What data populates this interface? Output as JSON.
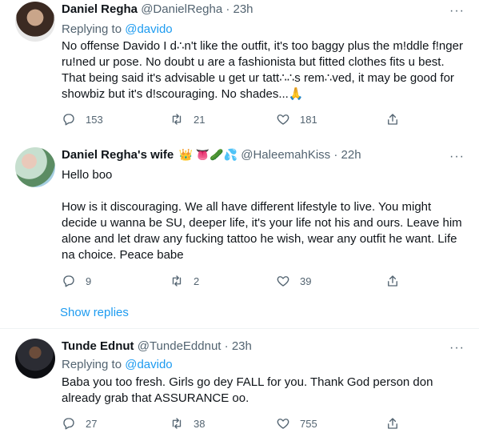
{
  "tweets": [
    {
      "name": "Daniel Regha",
      "handle": "@DanielRegha",
      "dot": "·",
      "time": "23h",
      "replying_prefix": "Replying to ",
      "replying_to": "@davido",
      "body": "No offense Davido I d∴n't like the outfit, it's too baggy plus the m!ddle f!nger ru!ned ur pose. No doubt u are a fashionista but fitted clothes fits u best. That being said it's advisable u get ur tatt∴∴s rem∴ved, it may be good for showbiz but it's d!scouraging. No shades...🙏",
      "replies": "153",
      "retweets": "21",
      "likes": "181"
    },
    {
      "name": "Daniel Regha's wife",
      "emojis": "👑 👅🥒💦",
      "handle": "@HaleemahKiss",
      "dot": "·",
      "time": "22h",
      "body_line1": "Hello boo",
      "body_line2": "How is it discouraging. We all have different lifestyle to live. You might decide u wanna be SU, deeper life, it's your life not his and ours. Leave him alone and let draw any fucking tattoo he wish, wear any outfit he want. Life na choice. Peace babe",
      "replies": "9",
      "retweets": "2",
      "likes": "39"
    },
    {
      "name": "Tunde Ednut",
      "handle": "@TundeEddnut",
      "dot": "·",
      "time": "23h",
      "replying_prefix": "Replying to ",
      "replying_to": "@davido",
      "body": "Baba you too fresh. Girls go dey FALL for you. Thank God person don already grab that ASSURANCE oo.",
      "replies": "27",
      "retweets": "38",
      "likes": "755"
    }
  ],
  "show_replies": "Show replies",
  "more_glyph": "···",
  "colors": {
    "accent": "#1d9bf0",
    "muted": "#536471",
    "text": "#0f1419"
  }
}
